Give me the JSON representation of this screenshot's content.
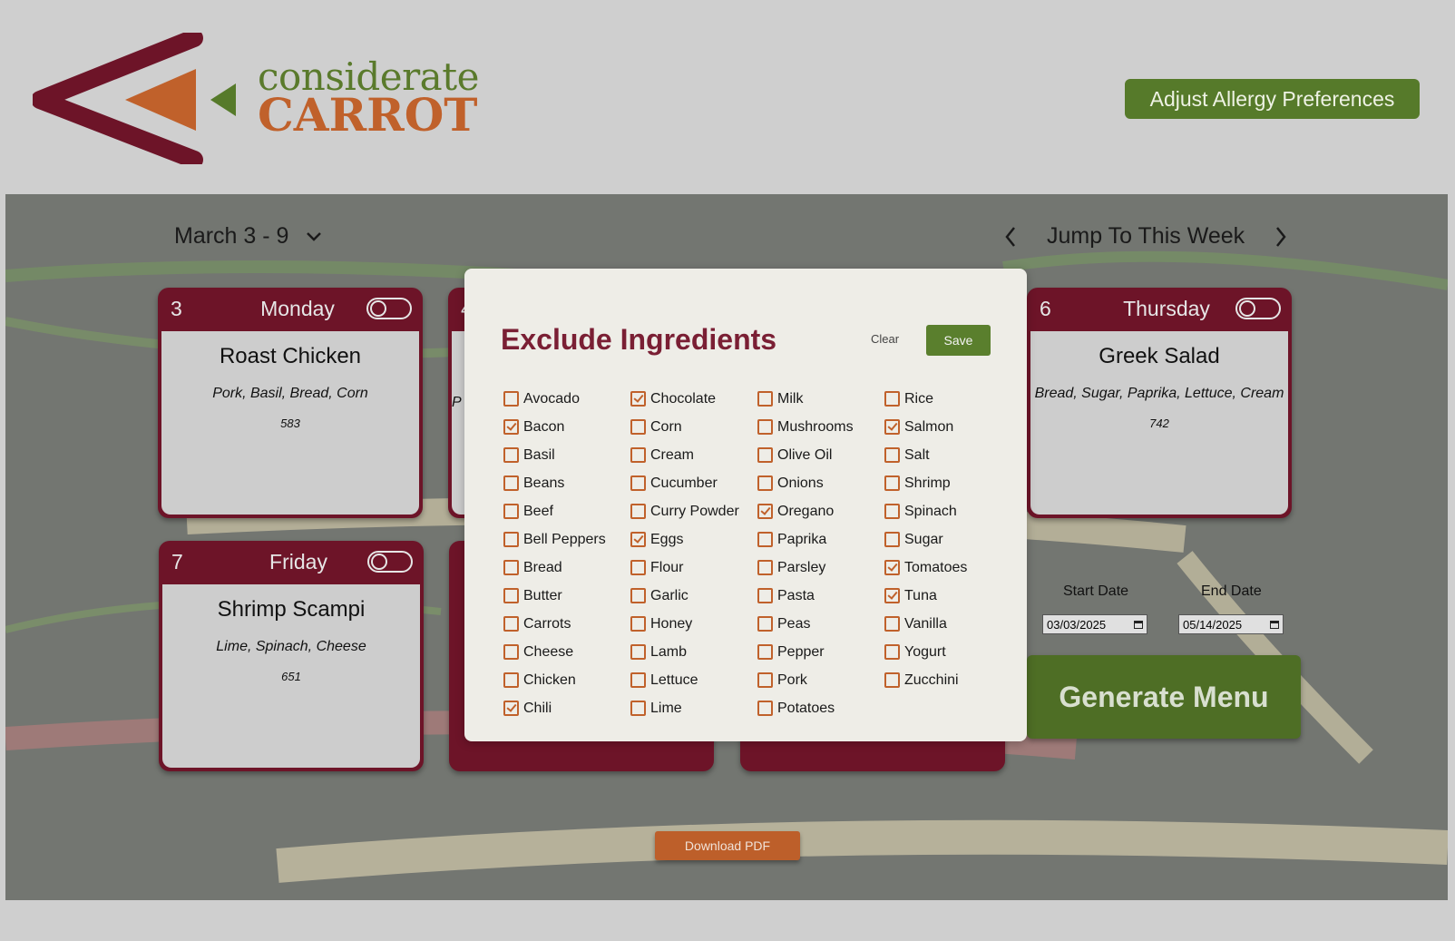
{
  "header": {
    "logo_line1": "considerate",
    "logo_line2": "CARROT",
    "allergy_button": "Adjust Allergy Preferences"
  },
  "week": {
    "range": "March 3 - 9",
    "jump_label": "Jump To This Week"
  },
  "cards": [
    {
      "num": "3",
      "day": "Monday",
      "meal": "Roast Chicken",
      "ingredients": "Pork, Basil, Bread, Corn",
      "calories": "583"
    },
    {
      "num": "6",
      "day": "Thursday",
      "meal": "Greek Salad",
      "ingredients": "Bread, Sugar, Paprika, Lettuce, Cream",
      "calories": "742"
    },
    {
      "num": "7",
      "day": "Friday",
      "meal": "Shrimp Scampi",
      "ingredients": "Lime, Spinach, Cheese",
      "calories": "651"
    }
  ],
  "partial_card": {
    "num": "4",
    "ingredients_fragment": "P"
  },
  "dates": {
    "start_label": "Start Date",
    "end_label": "End Date",
    "start_value": "03/03/2025",
    "end_value": "05/14/2025"
  },
  "generate_label": "Generate Menu",
  "pdf_label": "Download PDF",
  "modal": {
    "title": "Exclude Ingredients",
    "clear_label": "Clear",
    "save_label": "Save",
    "columns": [
      [
        {
          "name": "Avocado",
          "checked": false
        },
        {
          "name": "Bacon",
          "checked": true
        },
        {
          "name": "Basil",
          "checked": false
        },
        {
          "name": "Beans",
          "checked": false
        },
        {
          "name": "Beef",
          "checked": false
        },
        {
          "name": "Bell Peppers",
          "checked": false
        },
        {
          "name": "Bread",
          "checked": false
        },
        {
          "name": "Butter",
          "checked": false
        },
        {
          "name": "Carrots",
          "checked": false
        },
        {
          "name": "Cheese",
          "checked": false
        },
        {
          "name": "Chicken",
          "checked": false
        },
        {
          "name": "Chili",
          "checked": true
        }
      ],
      [
        {
          "name": "Chocolate",
          "checked": true
        },
        {
          "name": "Corn",
          "checked": false
        },
        {
          "name": "Cream",
          "checked": false
        },
        {
          "name": "Cucumber",
          "checked": false
        },
        {
          "name": "Curry Powder",
          "checked": false
        },
        {
          "name": "Eggs",
          "checked": true
        },
        {
          "name": "Flour",
          "checked": false
        },
        {
          "name": "Garlic",
          "checked": false
        },
        {
          "name": "Honey",
          "checked": false
        },
        {
          "name": "Lamb",
          "checked": false
        },
        {
          "name": "Lettuce",
          "checked": false
        },
        {
          "name": "Lime",
          "checked": false
        }
      ],
      [
        {
          "name": "Milk",
          "checked": false
        },
        {
          "name": "Mushrooms",
          "checked": false
        },
        {
          "name": "Olive Oil",
          "checked": false
        },
        {
          "name": "Onions",
          "checked": false
        },
        {
          "name": "Oregano",
          "checked": true
        },
        {
          "name": "Paprika",
          "checked": false
        },
        {
          "name": "Parsley",
          "checked": false
        },
        {
          "name": "Pasta",
          "checked": false
        },
        {
          "name": "Peas",
          "checked": false
        },
        {
          "name": "Pepper",
          "checked": false
        },
        {
          "name": "Pork",
          "checked": false
        },
        {
          "name": "Potatoes",
          "checked": false
        }
      ],
      [
        {
          "name": "Rice",
          "checked": false
        },
        {
          "name": "Salmon",
          "checked": true
        },
        {
          "name": "Salt",
          "checked": false
        },
        {
          "name": "Shrimp",
          "checked": false
        },
        {
          "name": "Spinach",
          "checked": false
        },
        {
          "name": "Sugar",
          "checked": false
        },
        {
          "name": "Tomatoes",
          "checked": true
        },
        {
          "name": "Tuna",
          "checked": true
        },
        {
          "name": "Vanilla",
          "checked": false
        },
        {
          "name": "Yogurt",
          "checked": false
        },
        {
          "name": "Zucchini",
          "checked": false
        }
      ]
    ]
  },
  "colors": {
    "brand_maroon": "#6d1428",
    "brand_green": "#567a2a",
    "brand_orange": "#c0612b",
    "title_red": "#7a1f34"
  }
}
